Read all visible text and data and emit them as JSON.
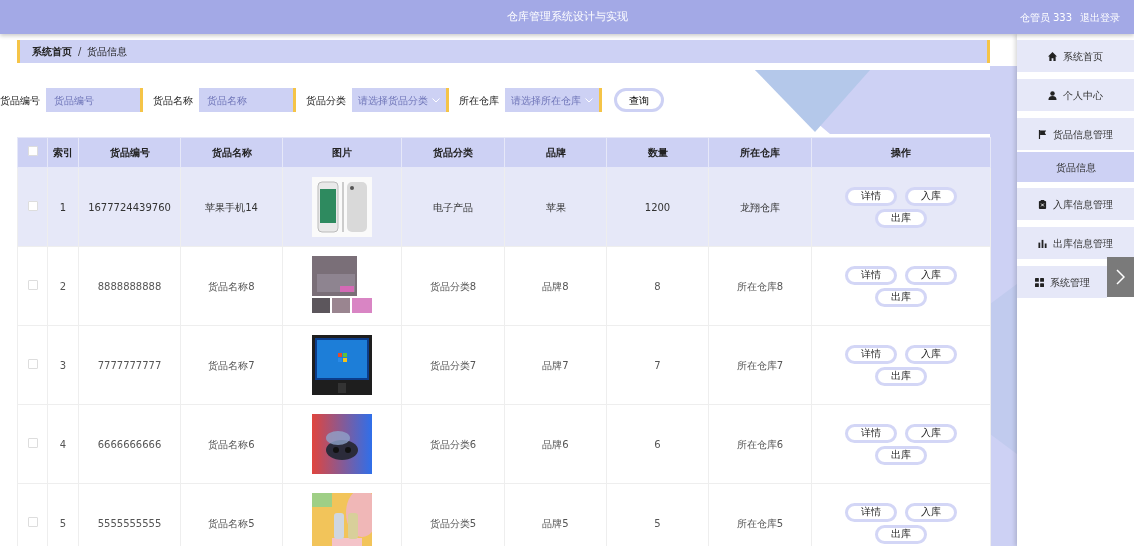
{
  "header": {
    "title": "仓库管理系统设计与实现",
    "user": "仓管员 333",
    "logout": "退出登录"
  },
  "breadcrumb": {
    "items": [
      "系统首页",
      "货品信息"
    ],
    "separator": "/"
  },
  "search": [
    {
      "label": "货品编号",
      "placeholder": "货品编号",
      "kind": "input"
    },
    {
      "label": "货品名称",
      "placeholder": "货品名称",
      "kind": "input"
    },
    {
      "label": "货品分类",
      "placeholder": "请选择货品分类",
      "kind": "select"
    },
    {
      "label": "所在仓库",
      "placeholder": "请选择所在仓库",
      "kind": "select"
    }
  ],
  "search_button": "查询",
  "table": {
    "select_all": {
      "checked": false
    },
    "columns": [
      "索引",
      "货品编号",
      "货品名称",
      "图片",
      "货品分类",
      "品牌",
      "数量",
      "所在仓库",
      "操作"
    ],
    "rows": [
      {
        "checked": false,
        "highlighted": true,
        "index": "1",
        "code": "1677724439760",
        "name": "苹果手机14",
        "picture": {
          "kind": "picture"
        },
        "category": "电子产品",
        "brand": "苹果",
        "quantity": "1200",
        "warehouse": "龙翔仓库",
        "actions": [
          "详情",
          "入库",
          "出库"
        ]
      },
      {
        "checked": false,
        "highlighted": false,
        "index": "2",
        "code": "8888888888",
        "name": "货品名称8",
        "picture": {
          "kind": "picture"
        },
        "category": "货品分类8",
        "brand": "品牌8",
        "quantity": "8",
        "warehouse": "所在仓库8",
        "actions": [
          "详情",
          "入库",
          "出库"
        ]
      },
      {
        "checked": false,
        "highlighted": false,
        "index": "3",
        "code": "7777777777",
        "name": "货品名称7",
        "picture": {
          "kind": "picture"
        },
        "category": "货品分类7",
        "brand": "品牌7",
        "quantity": "7",
        "warehouse": "所在仓库7",
        "actions": [
          "详情",
          "入库",
          "出库"
        ]
      },
      {
        "checked": false,
        "highlighted": false,
        "index": "4",
        "code": "6666666666",
        "name": "货品名称6",
        "picture": {
          "kind": "picture"
        },
        "category": "货品分类6",
        "brand": "品牌6",
        "quantity": "6",
        "warehouse": "所在仓库6",
        "actions": [
          "详情",
          "入库",
          "出库"
        ]
      },
      {
        "checked": false,
        "highlighted": false,
        "index": "5",
        "code": "5555555555",
        "name": "货品名称5",
        "picture": {
          "kind": "picture"
        },
        "category": "货品分类5",
        "brand": "品牌5",
        "quantity": "5",
        "warehouse": "所在仓库5",
        "actions": [
          "详情",
          "入库",
          "出库"
        ]
      }
    ]
  },
  "sidebar": {
    "items": [
      {
        "label": "系统首页"
      },
      {
        "label": "个人中心"
      },
      {
        "label": "货品信息管理",
        "children": [
          {
            "label": "货品信息",
            "selected": true
          }
        ]
      },
      {
        "label": "入库信息管理"
      },
      {
        "label": "出库信息管理"
      },
      {
        "label": "系统管理"
      }
    ]
  }
}
